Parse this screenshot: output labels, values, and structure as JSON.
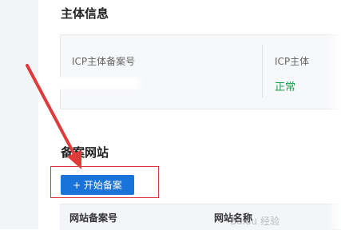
{
  "subject": {
    "section_title": "主体信息",
    "icp_number_label": "ICP主体备案号",
    "icp_status_label": "ICP主体",
    "status_value": "正常"
  },
  "website": {
    "section_title": "备案网站",
    "start_button": "+ 开始备案",
    "columns": [
      "网站备案号",
      "网站名称"
    ]
  },
  "annotation": {
    "color": "#d93b3b"
  },
  "watermark": {
    "text": "Baidu 经验"
  }
}
